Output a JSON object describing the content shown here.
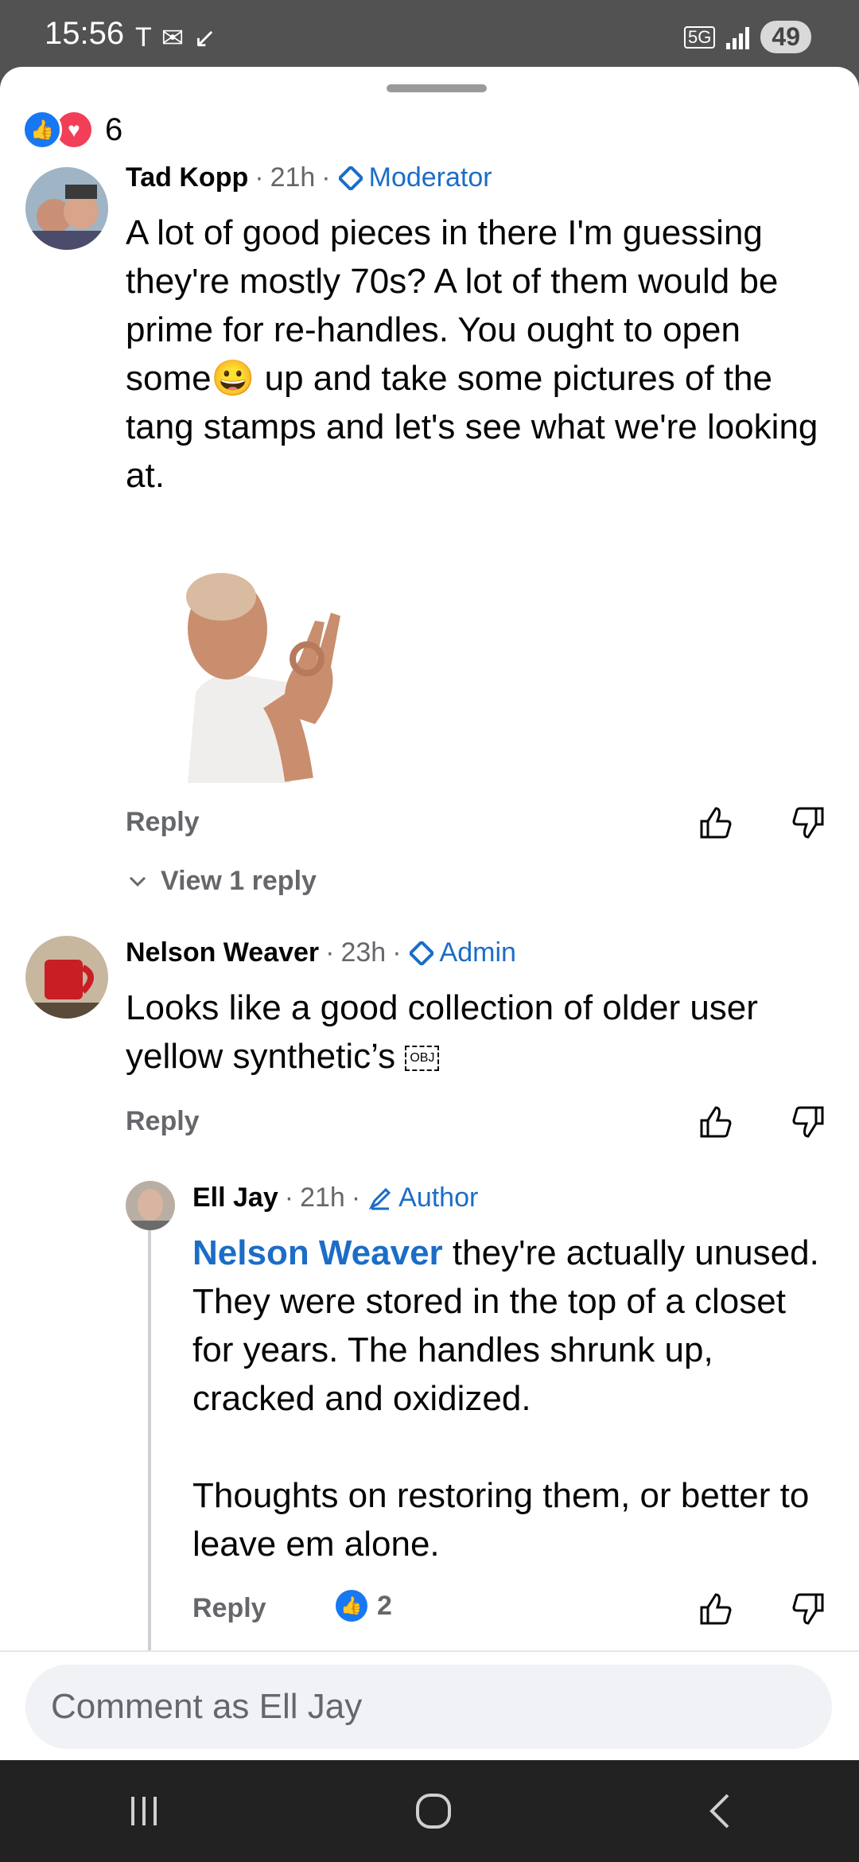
{
  "status": {
    "time": "15:56",
    "network": "5G",
    "battery": "49"
  },
  "reactions": {
    "count": "6"
  },
  "comments": [
    {
      "name": "Tad Kopp",
      "age": "21h",
      "badge": "Moderator",
      "text": "A lot of good pieces in there I'm guessing they're mostly 70s? A lot of them would be prime for re-handles. You ought to open some",
      "text_after": " up and take some pictures of the tang stamps and let's see what we're looking at.",
      "emoji": "😀",
      "reply_label": "Reply",
      "view_replies": "View 1 reply"
    },
    {
      "name": "Nelson Weaver",
      "age": "23h",
      "badge": "Admin",
      "text": "Looks like a good collection of older user yellow synthetic’s ",
      "obj": "OBJ",
      "reply_label": "Reply"
    },
    {
      "name": "Ell Jay",
      "age": "21h",
      "badge": "Author",
      "mention": "Nelson Weaver",
      "text": " they're actually unused. They were stored in the top of a closet for years. The handles shrunk up, cracked and oxidized.\n\nThoughts on restoring them, or better to leave em alone.",
      "reply_label": "Reply",
      "like_count": "2"
    }
  ],
  "composer": {
    "placeholder": "Comment as Ell Jay"
  },
  "colors": {
    "accent": "#1b6dc7",
    "like_blue": "#1877f2",
    "love_red": "#f33e58"
  }
}
